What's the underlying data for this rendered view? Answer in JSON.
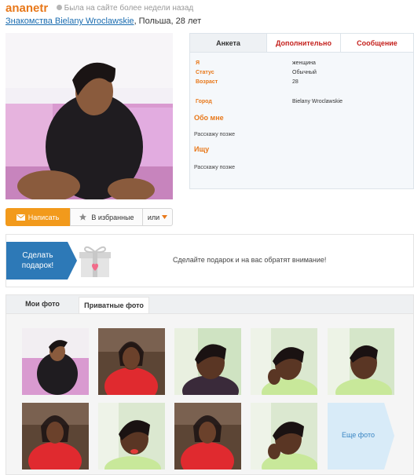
{
  "header": {
    "username": "ananetr",
    "online_status": "Была на сайте более недели назад",
    "city_link": "Знакомства Bielany Wroclawskie",
    "location_suffix": ", Польша, 28 лет"
  },
  "tabs": [
    "Анкета",
    "Дополнительно",
    "Сообщение"
  ],
  "profile": {
    "fields": [
      {
        "label": "Я",
        "value": "женщина"
      },
      {
        "label": "Статус",
        "value": "Обычный"
      },
      {
        "label": "Возраст",
        "value": "28"
      }
    ],
    "city": {
      "label": "Город",
      "value": "Bielany Wroclawskie"
    },
    "about": {
      "title": "Обо мне",
      "text": "Расскажу позже"
    },
    "seeking": {
      "title": "Ищу",
      "text": "Расскажу позже"
    }
  },
  "actions": {
    "write": "Написать",
    "favorite": "В избранные",
    "or": "или"
  },
  "gift": {
    "button_line1": "Сделать",
    "button_line2": "подарок!",
    "text": "Сделайте подарок и на вас обратят внимание!"
  },
  "photos": {
    "tab_mine": "Мои фото",
    "tab_private": "Приватные фото",
    "more": "Еще фото"
  },
  "colors": {
    "accent_orange": "#e8781a",
    "link_blue": "#1a6cb0",
    "tab_red": "#c4211d",
    "gift_blue": "#2d79b7"
  }
}
